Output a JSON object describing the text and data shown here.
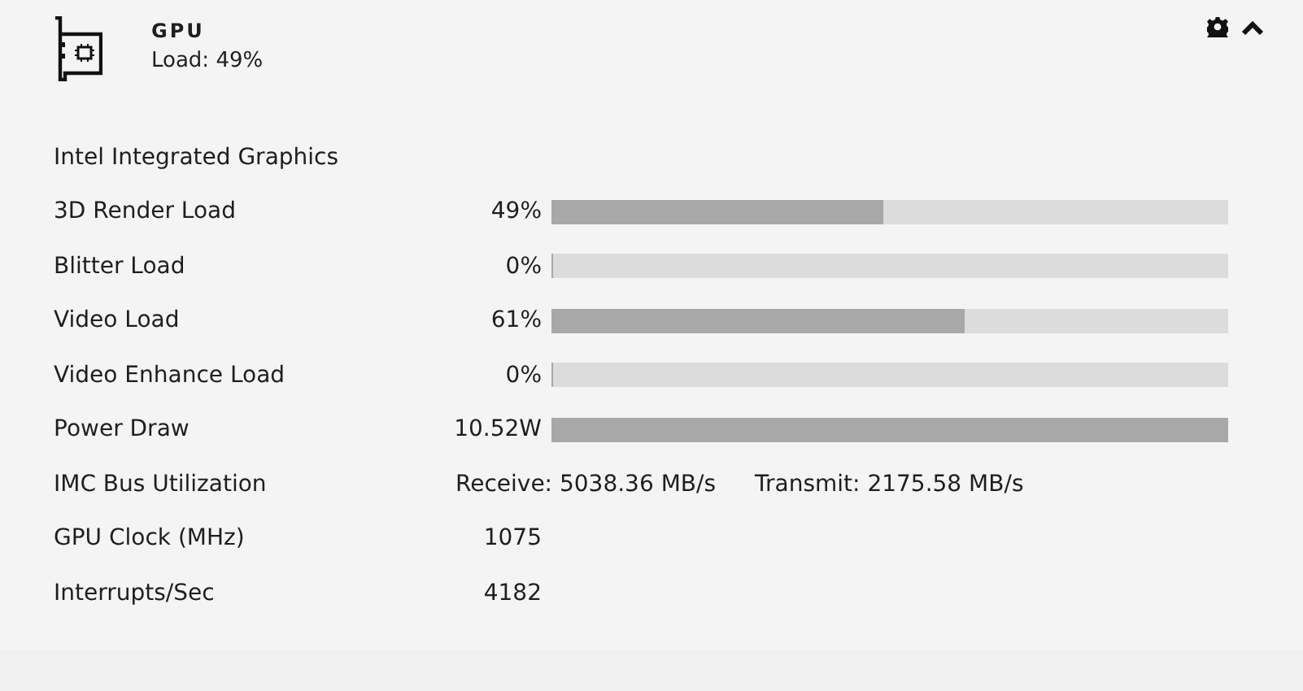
{
  "header": {
    "title": "GPU",
    "subtitle": "Load: 49%"
  },
  "section": "Intel Integrated Graphics",
  "rows": [
    {
      "kind": "bar",
      "label": "3D Render Load",
      "value": "49%",
      "level": 0.49
    },
    {
      "kind": "bar",
      "label": "Blitter Load",
      "value": "0%",
      "level": 0
    },
    {
      "kind": "bar",
      "label": "Video Load",
      "value": "61%",
      "level": 0.61
    },
    {
      "kind": "bar",
      "label": "Video Enhance Load",
      "value": "0%",
      "level": 0
    },
    {
      "kind": "bar",
      "label": "Power Draw",
      "value": "10.52W",
      "level": 1
    },
    {
      "kind": "pair",
      "label": "IMC Bus Utilization",
      "receive": "Receive: 5038.36 MB/s",
      "transmit": "Transmit: 2175.58 MB/s"
    },
    {
      "kind": "value",
      "label": "GPU Clock (MHz)",
      "value": "1075"
    },
    {
      "kind": "value",
      "label": "Interrupts/Sec",
      "value": "4182"
    }
  ]
}
